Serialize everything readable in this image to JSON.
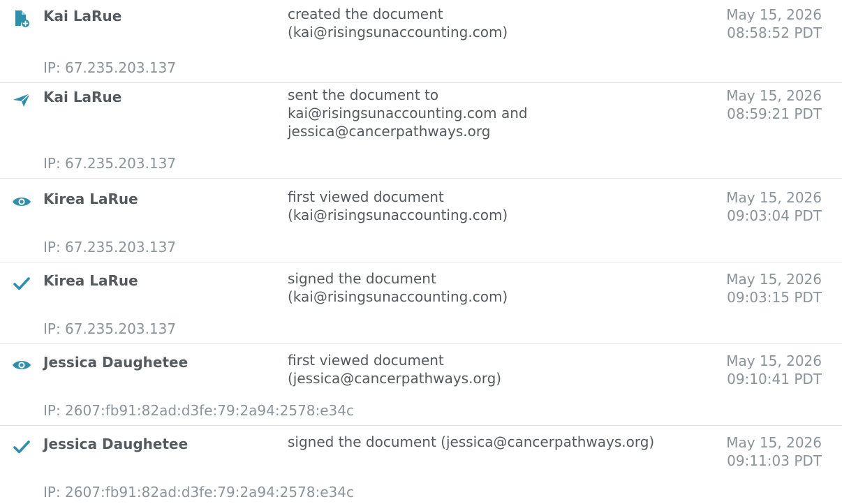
{
  "colors": {
    "icon": "#2c8fab",
    "name": "#555a5e",
    "muted": "#8a9499",
    "divider": "#e3e6e8"
  },
  "events": [
    {
      "icon": "document-created-icon",
      "actor": "Kai LaRue",
      "action_lines": [
        "created the document",
        "(kai@risingsunaccounting.com)"
      ],
      "date": "May 15, 2026",
      "time": "08:58:52 PDT",
      "ip": "IP: 67.235.203.137"
    },
    {
      "icon": "paper-plane-icon",
      "actor": "Kai LaRue",
      "action_lines": [
        "sent the document to",
        "kai@risingsunaccounting.com and",
        "jessica@cancerpathways.org"
      ],
      "date": "May 15, 2026",
      "time": "08:59:21 PDT",
      "ip": "IP: 67.235.203.137"
    },
    {
      "icon": "eye-icon",
      "actor": "Kirea LaRue",
      "action_lines": [
        "first viewed document",
        "(kai@risingsunaccounting.com)"
      ],
      "date": "May 15, 2026",
      "time": "09:03:04 PDT",
      "ip": "IP: 67.235.203.137"
    },
    {
      "icon": "checkmark-icon",
      "actor": "Kirea LaRue",
      "action_lines": [
        "signed the document",
        "(kai@risingsunaccounting.com)"
      ],
      "date": "May 15, 2026",
      "time": "09:03:15 PDT",
      "ip": "IP: 67.235.203.137"
    },
    {
      "icon": "eye-icon",
      "actor": "Jessica Daughetee",
      "action_lines": [
        "first viewed document",
        "(jessica@cancerpathways.org)"
      ],
      "date": "May 15, 2026",
      "time": "09:10:41 PDT",
      "ip": "IP: 2607:fb91:82ad:d3fe:79:2a94:2578:e34c"
    },
    {
      "icon": "checkmark-icon",
      "actor": "Jessica Daughetee",
      "action_lines": [
        "signed the document (jessica@cancerpathways.org)"
      ],
      "date": "May 15, 2026",
      "time": "09:11:03 PDT",
      "ip": "IP: 2607:fb91:82ad:d3fe:79:2a94:2578:e34c"
    }
  ]
}
